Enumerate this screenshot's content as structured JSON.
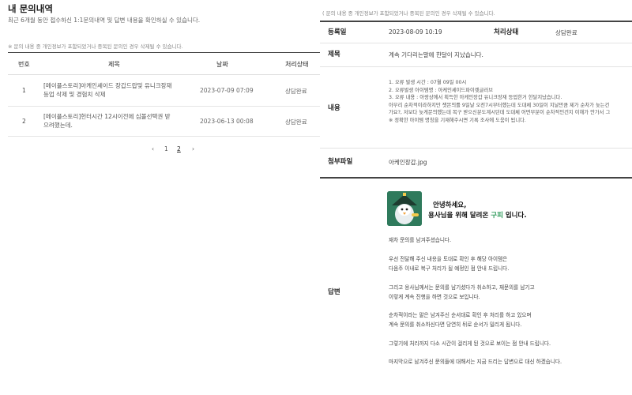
{
  "left": {
    "title": "내 문의내역",
    "subtitle": "최근 6개월 동안 접수하신 1:1문의내역 및 답변 내용을 확인하실 수 있습니다.",
    "notice": "※ 문의 내용 중 개인정보가 포함되었거나 중복된 문의인 경우 삭제될 수 있습니다.",
    "headers": {
      "no": "번호",
      "title": "제목",
      "date": "날짜",
      "status": "처리상태"
    },
    "rows": [
      {
        "no": "1",
        "title_line1": "[메이플스토리]아케인셰이드 장갑드랍및 유니크장재",
        "title_line2": "등업 삭제 및 경험치 삭제",
        "date": "2023-07-09 07:09",
        "status": "상담완료"
      },
      {
        "no": "2",
        "title_line1": "[메이플스토리]헌터시간 12시이전에 심볼선택권 받",
        "title_line2": "으려했는데.",
        "date": "2023-06-13 00:08",
        "status": "상담완료"
      }
    ],
    "pager": {
      "prev": "‹",
      "page1": "1",
      "page2": "2",
      "next": "›"
    }
  },
  "right": {
    "notice": "( 문의 내용 중 개인정보가 포함되었거나 중복된 문의인 경우 삭제될 수 있습니다.",
    "reg_label": "등록일",
    "reg_value": "2023-08-09 10:19",
    "status_label": "처리상태",
    "status_value": "상담완료",
    "subject_label": "제목",
    "subject_value": "계속 기다리는말에 한달이 지났습니다.",
    "content_label": "내용",
    "content_lines": [
      "1. 오류 발생 시간 : 07월 09일 00시",
      "2. 오류발생 아이템명 : 아케인셰이드파이렛글러브",
      "3. 오류 내용 : 아랑상에서 획득한 아케인장갑 유니크장재 등업한거 한달지났습니다.",
      "아무리 순차적이라하지만 잿몬의를 9일날 오전7시부터했는데 도대체 30일이 지날만큼 제가 순차가 늦는건",
      "가요?, 저보다 늦게문의했는데 복구 받으신분도계시던데 도대체 어떤부분이 순차적인건지 이해가 안가서 그",
      "※ 정확한 아이템 명칭을 기재해주시면 기록 조사에 도움이 됩니다."
    ],
    "attach_label": "첨부파일",
    "attach_value": "아케인장갑.jpg",
    "banner_line1": "안녕하세요,",
    "banner_line2_a": "용사님을 위해 달려온 ",
    "banner_line2_b": "구피",
    "banner_line2_c": " 입니다.",
    "answer_label": "답변",
    "answer_lines": [
      "재차 문의를 남겨주셨습니다.",
      "우선 전달해 주신 내용을 토대로 확인 후 해당 아이템은",
      "다음주 이내로 복구 처리가 될 예정인 점 안내 드립니다.",
      "그리고 용사님께서는 문의를 남기셨다가 취소하고, 재문의를 남기고",
      "이렇게 계속 진행을 하면 것으로 보입니다.",
      "순차적이라는 말은 남겨주신 순서대로 확인 후 처리를 하고 있으며",
      "계속 문의를 취소하신다면 당연히 뒤로 순서가 밀리게 됩니다.",
      "그렇기에 처리까지 다소 시간이 걸리게 된 것으로 보이는 점 안내 드립니다.",
      "마지막으로 남겨주신 문의들에 대해서는 지금 드리는 답변으로 대신 하겠습니다."
    ]
  },
  "icons": {
    "mascot": "penguin-mascot-icon"
  },
  "colors": {
    "accent_green": "#2e9a5a",
    "mascot_bg": "#2f7a5c"
  }
}
